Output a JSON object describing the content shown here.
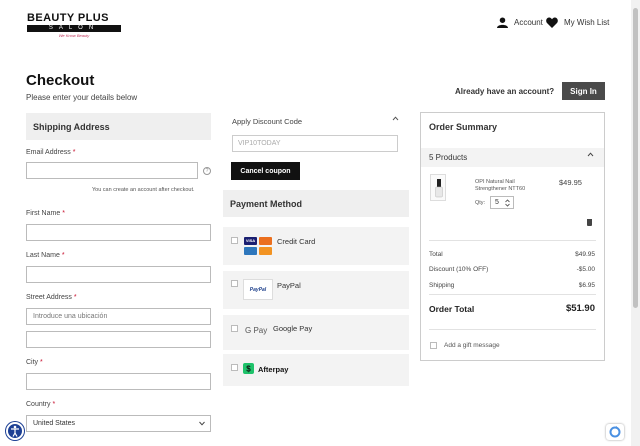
{
  "header": {
    "logo_top": "BEAUTY PLUS",
    "logo_bar": "SALON",
    "logo_script": "We Know Beauty",
    "account_label": "Account",
    "wishlist_label": "My Wish List"
  },
  "page": {
    "title": "Checkout",
    "subtitle": "Please enter your details below",
    "already_account": "Already have an account?",
    "signin_label": "Sign In"
  },
  "shipping": {
    "heading": "Shipping Address",
    "email_label": "Email Address",
    "email_value": "",
    "email_helper": "You can create an account after checkout.",
    "first_name_label": "First Name",
    "last_name_label": "Last Name",
    "street_label": "Street Address",
    "street_placeholder": "Introduce una ubicación",
    "city_label": "City",
    "country_label": "Country",
    "country_value": "United States",
    "required_mark": "*"
  },
  "discount": {
    "label": "Apply Discount Code",
    "code": "VIP10TODAY",
    "cancel_label": "Cancel coupon"
  },
  "payment": {
    "heading": "Payment Method",
    "options": [
      {
        "label": "Credit Card"
      },
      {
        "label": "PayPal"
      },
      {
        "label": "Google Pay"
      },
      {
        "label": "Afterpay"
      }
    ],
    "paypal_logo": "PayPal",
    "gpay_logo": "G Pay"
  },
  "summary": {
    "heading": "Order Summary",
    "products_label": "5 Products",
    "product_name": "OPI Natural Nail Strengthener NTT60",
    "product_price": "$49.95",
    "qty_label": "Qty:",
    "qty_value": "5",
    "total_label": "Total",
    "total_value": "$49.95",
    "discount_label": "Discount (10% OFF)",
    "discount_value": "-$5.00",
    "shipping_label": "Shipping",
    "shipping_value": "$6.95",
    "order_total_label": "Order Total",
    "order_total_value": "$51.90",
    "gift_label": "Add a gift message"
  },
  "colors": {
    "accent_dark": "#111111",
    "signin_bg": "#4a4a4a",
    "required": "#c8102e",
    "section_bg": "#efefef"
  }
}
